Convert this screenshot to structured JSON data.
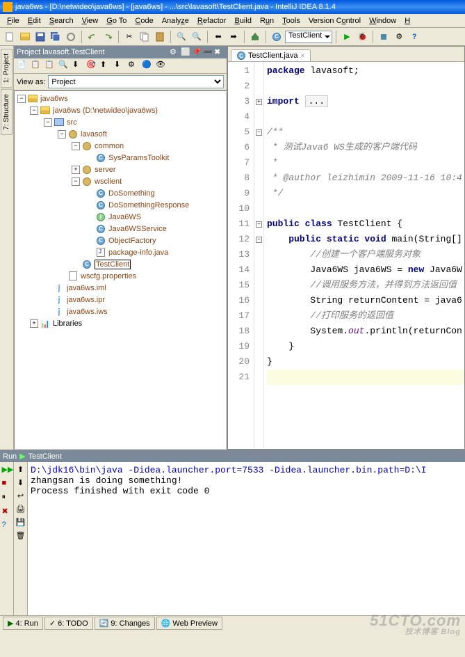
{
  "title": "java6ws - [D:\\netwideo\\java6ws] - [java6ws] - ...\\src\\lavasoft\\TestClient.java - IntelliJ IDEA 8.1.4",
  "menu": [
    "File",
    "Edit",
    "Search",
    "View",
    "Go To",
    "Code",
    "Analyze",
    "Refactor",
    "Build",
    "Run",
    "Tools",
    "Version Control",
    "Window",
    "H"
  ],
  "toolbar_config": "TestClient",
  "project": {
    "header": "Project lavasoft.TestClient",
    "viewas_label": "View as:",
    "viewas_value": "Project",
    "tree": {
      "root": "java6ws",
      "module": "java6ws",
      "module_path": "(D:\\netwideo\\java6ws)",
      "src": "src",
      "pkg_lavasoft": "lavasoft",
      "pkg_common": "common",
      "cls_sysparams": "SysParamsToolkit",
      "pkg_server": "server",
      "pkg_wsclient": "wsclient",
      "cls_dosomething": "DoSomething",
      "cls_dosomethingresp": "DoSomethingResponse",
      "iface_java6ws": "Java6WS",
      "cls_java6wsservice": "Java6WSService",
      "cls_objectfactory": "ObjectFactory",
      "file_pkginfo": "package-info.java",
      "cls_testclient": "TestClient",
      "file_wscfg": "wscfg.properties",
      "file_iml": "java6ws.iml",
      "file_ipr": "java6ws.ipr",
      "file_iws": "java6ws.iws",
      "libraries": "Libraries"
    }
  },
  "leftbar": {
    "project": "1: Project",
    "structure": "7: Structure"
  },
  "editor": {
    "tab": "TestClient.java",
    "lines": [
      {
        "n": 1,
        "t": "package",
        "r": " lavasoft;"
      },
      {
        "n": 2,
        "t": ""
      },
      {
        "n": 3,
        "t": "import",
        "r": " ",
        "box": "..."
      },
      {
        "n": 4,
        "t": ""
      },
      {
        "n": 5,
        "c": "/**"
      },
      {
        "n": 6,
        "c": " * 测试Java6 WS生成的客户端代码"
      },
      {
        "n": 7,
        "c": " *"
      },
      {
        "n": 8,
        "c": " * @author leizhimin 2009-11-16 10:4"
      },
      {
        "n": 9,
        "c": " */"
      },
      {
        "n": 10,
        "t": ""
      },
      {
        "n": 11,
        "k": "public class",
        "r": " TestClient {"
      },
      {
        "n": 12,
        "k": "    public static void",
        "r": " main(String[]"
      },
      {
        "n": 13,
        "c": "        //创建一个客户端服务对象"
      },
      {
        "n": 14,
        "p": "        Java6WS java6WS = ",
        "k2": "new",
        "p2": " Java6W"
      },
      {
        "n": 15,
        "c": "        //调用服务方法，并得到方法返回值"
      },
      {
        "n": 16,
        "p": "        String returnContent = java6"
      },
      {
        "n": 17,
        "c": "        //打印服务的返回值"
      },
      {
        "n": 18,
        "p": "        System.",
        "it": "out",
        "p2": ".println(returnCon"
      },
      {
        "n": 19,
        "p": "    }"
      },
      {
        "n": 20,
        "p": "}"
      },
      {
        "n": 21,
        "p": ""
      }
    ]
  },
  "run": {
    "header_prefix": "Run",
    "header_config": "TestClient",
    "out1": "D:\\jdk16\\bin\\java -Didea.launcher.port=7533 -Didea.launcher.bin.path=D:\\I",
    "out2": "zhangsan is doing something!",
    "out3": "",
    "out4": "Process finished with exit code 0"
  },
  "bottom": {
    "run": "4: Run",
    "todo": "6: TODO",
    "changes": "9: Changes",
    "web": "Web Preview"
  },
  "watermark": {
    "main": "51CTO.com",
    "sub": "技术博客 Blog"
  }
}
